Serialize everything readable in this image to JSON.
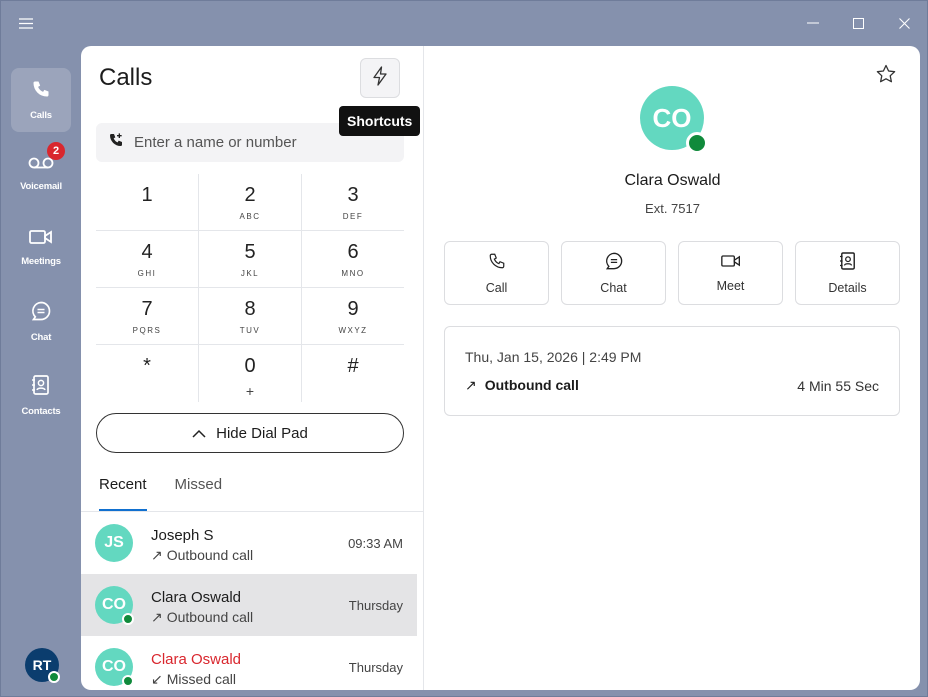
{
  "window": {
    "menu_icon": "hamburger-icon",
    "controls": [
      "minimize-icon",
      "maximize-icon",
      "close-icon"
    ]
  },
  "rail": {
    "items": [
      {
        "label": "Calls",
        "icon": "phone-icon",
        "active": true
      },
      {
        "label": "Voicemail",
        "icon": "voicemail-icon",
        "badge": "2"
      },
      {
        "label": "Meetings",
        "icon": "video-icon"
      },
      {
        "label": "Chat",
        "icon": "chat-icon"
      },
      {
        "label": "Contacts",
        "icon": "contacts-icon"
      }
    ],
    "avatar_initials": "RT"
  },
  "calls": {
    "title": "Calls",
    "shortcuts_tooltip": "Shortcuts",
    "search_placeholder": "Enter a name or number",
    "dialpad": [
      {
        "digit": "1",
        "letters": ""
      },
      {
        "digit": "2",
        "letters": "ABC"
      },
      {
        "digit": "3",
        "letters": "DEF"
      },
      {
        "digit": "4",
        "letters": "GHI"
      },
      {
        "digit": "5",
        "letters": "JKL"
      },
      {
        "digit": "6",
        "letters": "MNO"
      },
      {
        "digit": "7",
        "letters": "PQRS"
      },
      {
        "digit": "8",
        "letters": "TUV"
      },
      {
        "digit": "9",
        "letters": "WXYZ"
      },
      {
        "digit": "*",
        "letters": ""
      },
      {
        "digit": "0",
        "letters": "+"
      },
      {
        "digit": "#",
        "letters": ""
      }
    ],
    "hide_dialpad_label": "Hide Dial Pad",
    "tabs": [
      "Recent",
      "Missed"
    ],
    "recent": [
      {
        "initials": "JS",
        "name": "Joseph S",
        "type": "Outbound call",
        "time": "09:33 AM",
        "presence": false,
        "missed": false,
        "selected": false
      },
      {
        "initials": "CO",
        "name": "Clara Oswald",
        "type": "Outbound call",
        "time": "Thursday",
        "presence": true,
        "missed": false,
        "selected": true
      },
      {
        "initials": "CO",
        "name": "Clara Oswald",
        "type": "Missed call",
        "time": "Thursday",
        "presence": true,
        "missed": true,
        "selected": false
      }
    ]
  },
  "contact": {
    "initials": "CO",
    "name": "Clara Oswald",
    "extension": "Ext. 7517",
    "actions": [
      {
        "label": "Call",
        "icon": "phone-icon"
      },
      {
        "label": "Chat",
        "icon": "chat-icon"
      },
      {
        "label": "Meet",
        "icon": "video-icon"
      },
      {
        "label": "Details",
        "icon": "contact-card-icon"
      }
    ],
    "history": {
      "datetime": "Thu, Jan 15, 2026 | 2:49 PM",
      "type": "Outbound call",
      "duration": "4 Min 55 Sec"
    }
  },
  "colors": {
    "frame": "#8591ad",
    "avatar": "#63d8c0",
    "presence": "#108a3b",
    "badge": "#d9272e",
    "missed": "#d9272e",
    "accent": "#1170cf"
  }
}
